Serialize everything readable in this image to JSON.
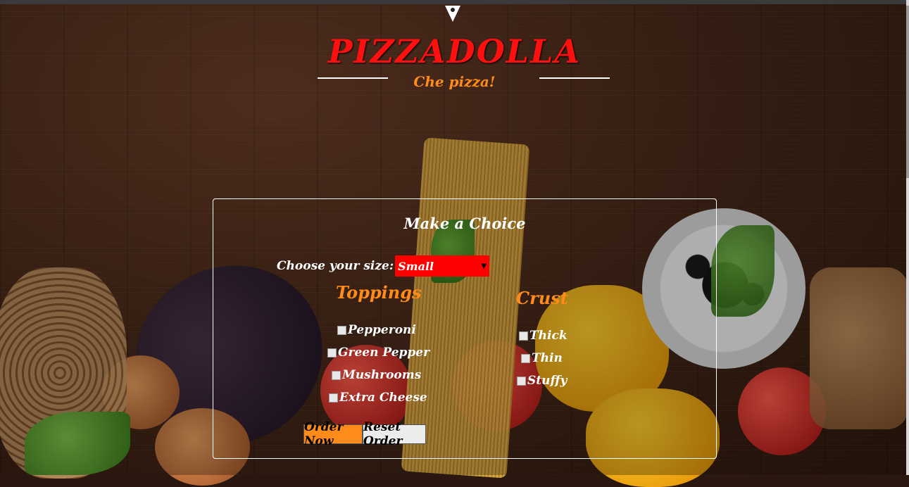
{
  "header": {
    "title": "PIZZADOLLA",
    "subtitle": "Che pizza!"
  },
  "form": {
    "heading": "Make a Choice",
    "size_label": "Choose your size:",
    "size_selected": "Small",
    "toppings_heading": "Toppings",
    "toppings": [
      "Pepperoni",
      "Green Pepper",
      "Mushrooms",
      "Extra Cheese"
    ],
    "crust_heading": "Crust",
    "crusts": [
      "Thick",
      "Thin",
      "Stuffy"
    ],
    "order_button": "Order Now",
    "reset_button": "Reset Order"
  },
  "colors": {
    "title": "#ff1010",
    "accent": "#ff8c1a",
    "select_bg": "#ff0000"
  },
  "icons": {
    "logo": "pizza-slice-pin-icon",
    "dropdown": "caret-down-icon"
  }
}
